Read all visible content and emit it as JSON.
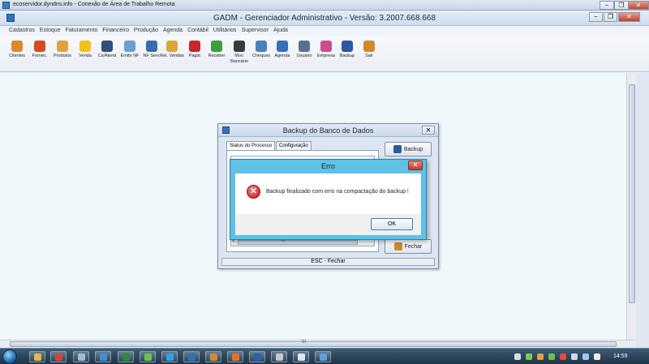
{
  "rdp": {
    "title": "ecoservidor.dyndns.info - Conexão de Área de Trabalho Remota",
    "minimize": "−",
    "restore": "❐",
    "close": "✕"
  },
  "app": {
    "title": "GADM - Gerenciador Administrativo - Versão: 3.2007.668.668",
    "minimize": "−",
    "maximize": "❐",
    "close": "✕",
    "menu": [
      "Cadastros",
      "Estoque",
      "Faturamento",
      "Financeiro",
      "Produção",
      "Agenda",
      "Contábil",
      "Utilitários",
      "Supervisor",
      "Ajuda"
    ],
    "toolbar": [
      {
        "label": "Clientes",
        "icon": "clients-icon",
        "color": "#d98b2b"
      },
      {
        "label": "Fornec.",
        "icon": "supplier-icon",
        "color": "#d24d1f"
      },
      {
        "label": "Produtos",
        "icon": "products-icon",
        "color": "#e0a33c"
      },
      {
        "label": "Venda",
        "icon": "sale-icon",
        "color": "#f2c21b"
      },
      {
        "label": "Cx/Atend",
        "icon": "cashier-icon",
        "color": "#2f4f7a"
      },
      {
        "label": "Emitir NF",
        "icon": "invoice-icon",
        "color": "#6a9ed1"
      },
      {
        "label": "NF Serv.",
        "icon": "service-invoice-icon",
        "color": "#3a6cb0"
      },
      {
        "label": "Rel. Vendas",
        "icon": "sales-report-icon",
        "color": "#d9a63a"
      },
      {
        "label": "Pagar",
        "icon": "pay-icon",
        "color": "#c8262b"
      },
      {
        "label": "Receber",
        "icon": "receive-icon",
        "color": "#3b9d3d"
      },
      {
        "label": "Mov. Bancário",
        "icon": "bank-icon",
        "color": "#3a3a3a"
      },
      {
        "label": "Cheques",
        "icon": "cheques-icon",
        "color": "#4a7fc0"
      },
      {
        "label": "Agenda",
        "icon": "calendar-icon",
        "color": "#3570b8"
      },
      {
        "label": "Usuário",
        "icon": "user-icon",
        "color": "#5b6f8d"
      },
      {
        "label": "Empresa",
        "icon": "company-icon",
        "color": "#c84e8e"
      },
      {
        "label": "Backup",
        "icon": "backup-icon",
        "color": "#2b57a3"
      },
      {
        "label": "Sair",
        "icon": "exit-icon",
        "color": "#d1892a"
      }
    ],
    "hscroll_grip": "III"
  },
  "backup_dialog": {
    "title": "Backup do Banco de Dados",
    "close": "✕",
    "tabs": [
      "Status do Processo",
      "Configuração"
    ],
    "backup_button": "Backup",
    "close_button": "Fechar",
    "list_left_arrow": "<",
    "list_grip": "III",
    "status": "ESC - Fechar"
  },
  "error_dialog": {
    "title": "Erro",
    "close": "✕",
    "icon_glyph": "✕",
    "message": "Backup finalizado com erro na compactação do backup !",
    "ok": "OK"
  },
  "taskbar": {
    "clock": "14:59",
    "items": [
      {
        "icon": "folder-icon",
        "color": "#e7b64a"
      },
      {
        "icon": "chrome-icon",
        "color": "#d9443a"
      },
      {
        "icon": "app-icon",
        "color": "#9fb9d9"
      },
      {
        "icon": "ie-icon",
        "color": "#3d8fd8"
      },
      {
        "icon": "excel-icon",
        "color": "#2e8b3a"
      },
      {
        "icon": "arrow-icon",
        "color": "#6cc24a"
      },
      {
        "icon": "skype-icon",
        "color": "#2aa4e4"
      },
      {
        "icon": "gadm-icon",
        "color": "#2f72c0"
      },
      {
        "icon": "archive-icon",
        "color": "#d0883a"
      },
      {
        "icon": "firefox-icon",
        "color": "#e5712a"
      },
      {
        "icon": "word-icon",
        "color": "#2b5fb3"
      },
      {
        "icon": "settings-icon",
        "color": "#c9c9c9"
      },
      {
        "icon": "window-icon",
        "color": "#dfe6ee"
      },
      {
        "icon": "remote-desktop-icon",
        "color": "#5aa0dd"
      }
    ]
  }
}
